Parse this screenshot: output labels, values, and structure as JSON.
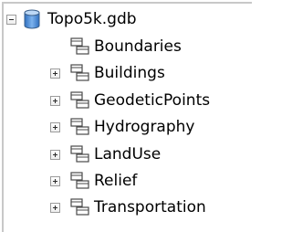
{
  "tree": {
    "root": {
      "label": "Topo5k.gdb",
      "expanded": true,
      "icon": "database-cylinder-icon"
    },
    "items": [
      {
        "label": "Boundaries",
        "has_expander": false,
        "icon": "feature-dataset-icon"
      },
      {
        "label": "Buildings",
        "has_expander": true,
        "icon": "feature-dataset-icon"
      },
      {
        "label": "GeodeticPoints",
        "has_expander": true,
        "icon": "feature-dataset-icon"
      },
      {
        "label": "Hydrography",
        "has_expander": true,
        "icon": "feature-dataset-icon"
      },
      {
        "label": "LandUse",
        "has_expander": true,
        "icon": "feature-dataset-icon"
      },
      {
        "label": "Relief",
        "has_expander": true,
        "icon": "feature-dataset-icon"
      },
      {
        "label": "Transportation",
        "has_expander": true,
        "icon": "feature-dataset-icon"
      }
    ]
  },
  "colors": {
    "database_fill": "#4f8fd8",
    "icon_outline": "#4a4a4a",
    "border": "#c8c8c8"
  }
}
